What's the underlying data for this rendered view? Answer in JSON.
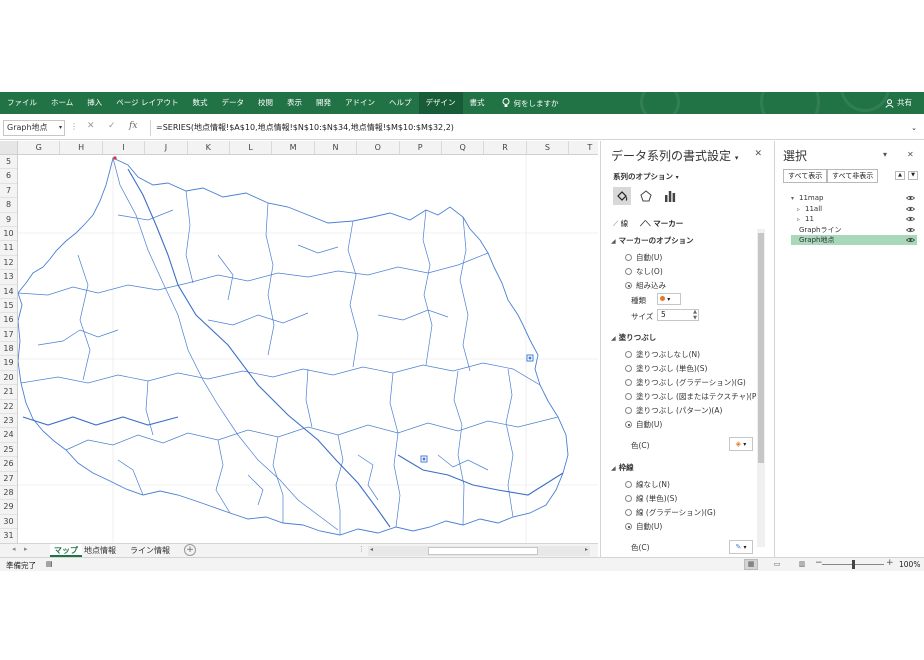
{
  "ribbon": {
    "tabs": [
      "ファイル",
      "ホーム",
      "挿入",
      "ページ レイアウト",
      "数式",
      "データ",
      "校閲",
      "表示",
      "開発",
      "アドイン",
      "ヘルプ",
      "デザイン",
      "書式"
    ],
    "active_tab": "デザイン",
    "tell_me": "何をしますか",
    "share": "共有"
  },
  "formula_bar": {
    "name_box": "Graph地点",
    "formula": "=SERIES(地点情報!$A$10,地点情報!$N$10:$N$34,地点情報!$M$10:$M$32,2)"
  },
  "sheet": {
    "columns": [
      "G",
      "H",
      "I",
      "J",
      "K",
      "L",
      "M",
      "N",
      "O",
      "P",
      "Q",
      "R",
      "S",
      "T"
    ],
    "rows": [
      "5",
      "6",
      "7",
      "8",
      "9",
      "10",
      "11",
      "12",
      "13",
      "14",
      "15",
      "16",
      "17",
      "18",
      "19",
      "20",
      "21",
      "22",
      "23",
      "24",
      "25",
      "26",
      "27",
      "28",
      "29",
      "30",
      "31"
    ],
    "tabs": [
      "マップ",
      "地点情報",
      "ライン情報"
    ],
    "active_tab": "マップ"
  },
  "status": {
    "ready": "準備完了",
    "zoom": "100%"
  },
  "format_pane": {
    "title": "データ系列の書式設定",
    "series_options": "系列のオプション",
    "subtab_line": "線",
    "subtab_marker": "マーカー",
    "marker_options": {
      "heading": "マーカーのオプション",
      "options": [
        "自動(U)",
        "なし(O)",
        "組み込み"
      ],
      "selected": 2,
      "type_label": "種類",
      "size_label": "サイズ",
      "size_value": "5"
    },
    "fill": {
      "heading": "塗りつぶし",
      "options": [
        "塗りつぶしなし(N)",
        "塗りつぶし (単色)(S)",
        "塗りつぶし (グラデーション)(G)",
        "塗りつぶし (図またはテクスチャ)(P)",
        "塗りつぶし (パターン)(A)",
        "自動(U)"
      ],
      "selected": 5,
      "color_label": "色(C)"
    },
    "border": {
      "heading": "枠線",
      "options": [
        "線なし(N)",
        "線 (単色)(S)",
        "線 (グラデーション)(G)",
        "自動(U)"
      ],
      "selected": 3,
      "color_label": "色(C)"
    }
  },
  "selection_pane": {
    "title": "選択",
    "show_all": "すべて表示",
    "hide_all": "すべて非表示",
    "items": [
      {
        "label": "11map",
        "indent": 0,
        "expand": "▾"
      },
      {
        "label": "11all",
        "indent": 1,
        "expand": "▹"
      },
      {
        "label": "11",
        "indent": 1,
        "expand": "▹"
      },
      {
        "label": "Graphライン",
        "indent": 0,
        "expand": ""
      },
      {
        "label": "Graph地点",
        "indent": 0,
        "expand": "",
        "selected": true
      }
    ]
  },
  "colors": {
    "ribbon": "#217346",
    "map_line": "#4a7fd4",
    "marker": "#e87722",
    "selection": "#a8d8b9"
  }
}
